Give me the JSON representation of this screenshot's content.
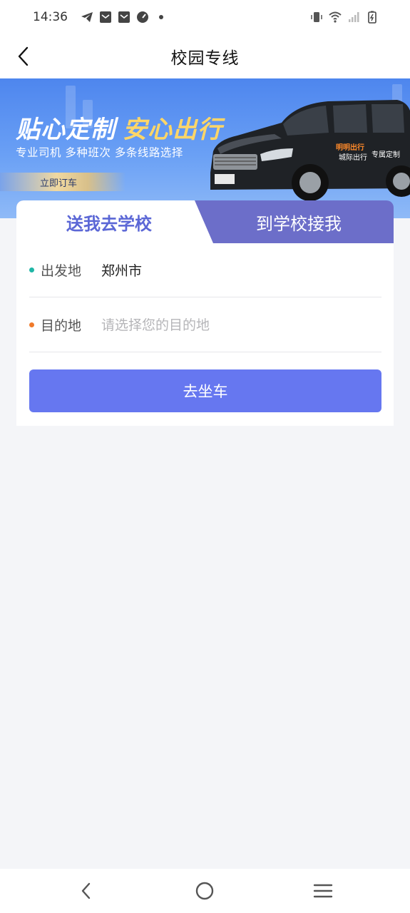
{
  "status_bar": {
    "time": "14:36",
    "left_icons": [
      "telegram-icon",
      "mail-icon",
      "mail-icon",
      "speedometer-icon",
      "dot-icon"
    ],
    "right_icons": [
      "vibrate-icon",
      "wifi-icon",
      "signal-icon",
      "battery-charging-icon"
    ]
  },
  "nav": {
    "back_icon": "chevron-left-icon",
    "title": "校园专线"
  },
  "banner": {
    "headline_white": "贴心定制",
    "headline_gold": "安心出行",
    "subtitle": "专业司机 多种班次 多条线路选择",
    "cta_label": "立即订车",
    "van_brand": "明明出行",
    "van_text_1": "城际出行",
    "van_text_2": "专属定制"
  },
  "tabs": {
    "active_label": "送我去学校",
    "inactive_label": "到学校接我"
  },
  "form": {
    "origin": {
      "label": "出发地",
      "value": "郑州市",
      "dot_color": "#1fb6a6"
    },
    "destination": {
      "label": "目的地",
      "placeholder": "请选择您的目的地",
      "dot_color": "#f07a2a"
    },
    "submit_label": "去坐车"
  },
  "colors": {
    "accent": "#6677f0",
    "tab_inactive_bg": "#6c6ec9",
    "tab_active_text": "#5b67d6",
    "page_bg": "#f4f5f8"
  },
  "bottom_nav": {
    "icons": [
      "back-triangle-icon",
      "home-circle-icon",
      "menu-lines-icon"
    ]
  }
}
